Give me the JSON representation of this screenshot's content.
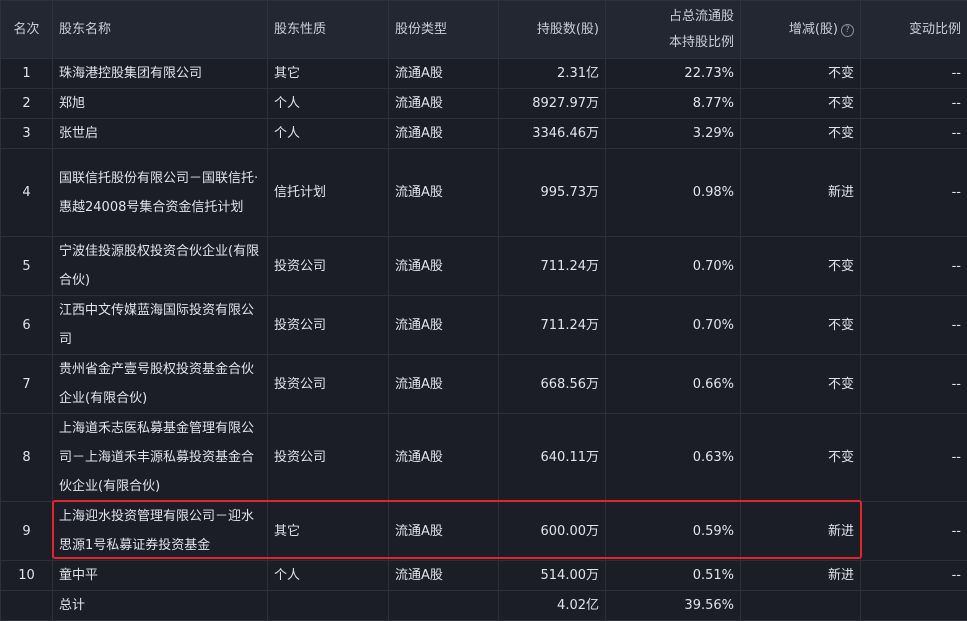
{
  "columns": {
    "rank": "名次",
    "name": "股东名称",
    "nature": "股东性质",
    "share_type": "股份类型",
    "holding": "持股数(股)",
    "ratio_line1": "占总流通股",
    "ratio_line2": "本持股比例",
    "change": "增减(股)",
    "change_pct": "变动比例"
  },
  "rows": [
    {
      "rank": "1",
      "name": "珠海港控股集团有限公司",
      "nature": "其它",
      "share_type": "流通A股",
      "holding": "2.31亿",
      "ratio": "22.73%",
      "change": "不变",
      "change_pct": "--"
    },
    {
      "rank": "2",
      "name": "郑旭",
      "nature": "个人",
      "share_type": "流通A股",
      "holding": "8927.97万",
      "ratio": "8.77%",
      "change": "不变",
      "change_pct": "--"
    },
    {
      "rank": "3",
      "name": "张世启",
      "nature": "个人",
      "share_type": "流通A股",
      "holding": "3346.46万",
      "ratio": "3.29%",
      "change": "不变",
      "change_pct": "--"
    },
    {
      "rank": "4",
      "name": "国联信托股份有限公司－国联信托·惠越24008号集合资金信托计划",
      "nature": "信托计划",
      "share_type": "流通A股",
      "holding": "995.73万",
      "ratio": "0.98%",
      "change": "新进",
      "change_pct": "--"
    },
    {
      "rank": "5",
      "name": "宁波佳投源股权投资合伙企业(有限合伙)",
      "nature": "投资公司",
      "share_type": "流通A股",
      "holding": "711.24万",
      "ratio": "0.70%",
      "change": "不变",
      "change_pct": "--"
    },
    {
      "rank": "6",
      "name": "江西中文传媒蓝海国际投资有限公司",
      "nature": "投资公司",
      "share_type": "流通A股",
      "holding": "711.24万",
      "ratio": "0.70%",
      "change": "不变",
      "change_pct": "--"
    },
    {
      "rank": "7",
      "name": "贵州省金产壹号股权投资基金合伙企业(有限合伙)",
      "nature": "投资公司",
      "share_type": "流通A股",
      "holding": "668.56万",
      "ratio": "0.66%",
      "change": "不变",
      "change_pct": "--"
    },
    {
      "rank": "8",
      "name": "上海道禾志医私募基金管理有限公司－上海道禾丰源私募投资基金合伙企业(有限合伙)",
      "nature": "投资公司",
      "share_type": "流通A股",
      "holding": "640.11万",
      "ratio": "0.63%",
      "change": "不变",
      "change_pct": "--"
    },
    {
      "rank": "9",
      "name": "上海迎水投资管理有限公司－迎水思源1号私募证券投资基金",
      "nature": "其它",
      "share_type": "流通A股",
      "holding": "600.00万",
      "ratio": "0.59%",
      "change": "新进",
      "change_pct": "--"
    },
    {
      "rank": "10",
      "name": "童中平",
      "nature": "个人",
      "share_type": "流通A股",
      "holding": "514.00万",
      "ratio": "0.51%",
      "change": "新进",
      "change_pct": "--"
    }
  ],
  "total": {
    "label": "总计",
    "holding": "4.02亿",
    "ratio": "39.56%"
  },
  "colors": {
    "highlight": "#e0262a",
    "background": "#1b1e26",
    "header": "#232731"
  }
}
